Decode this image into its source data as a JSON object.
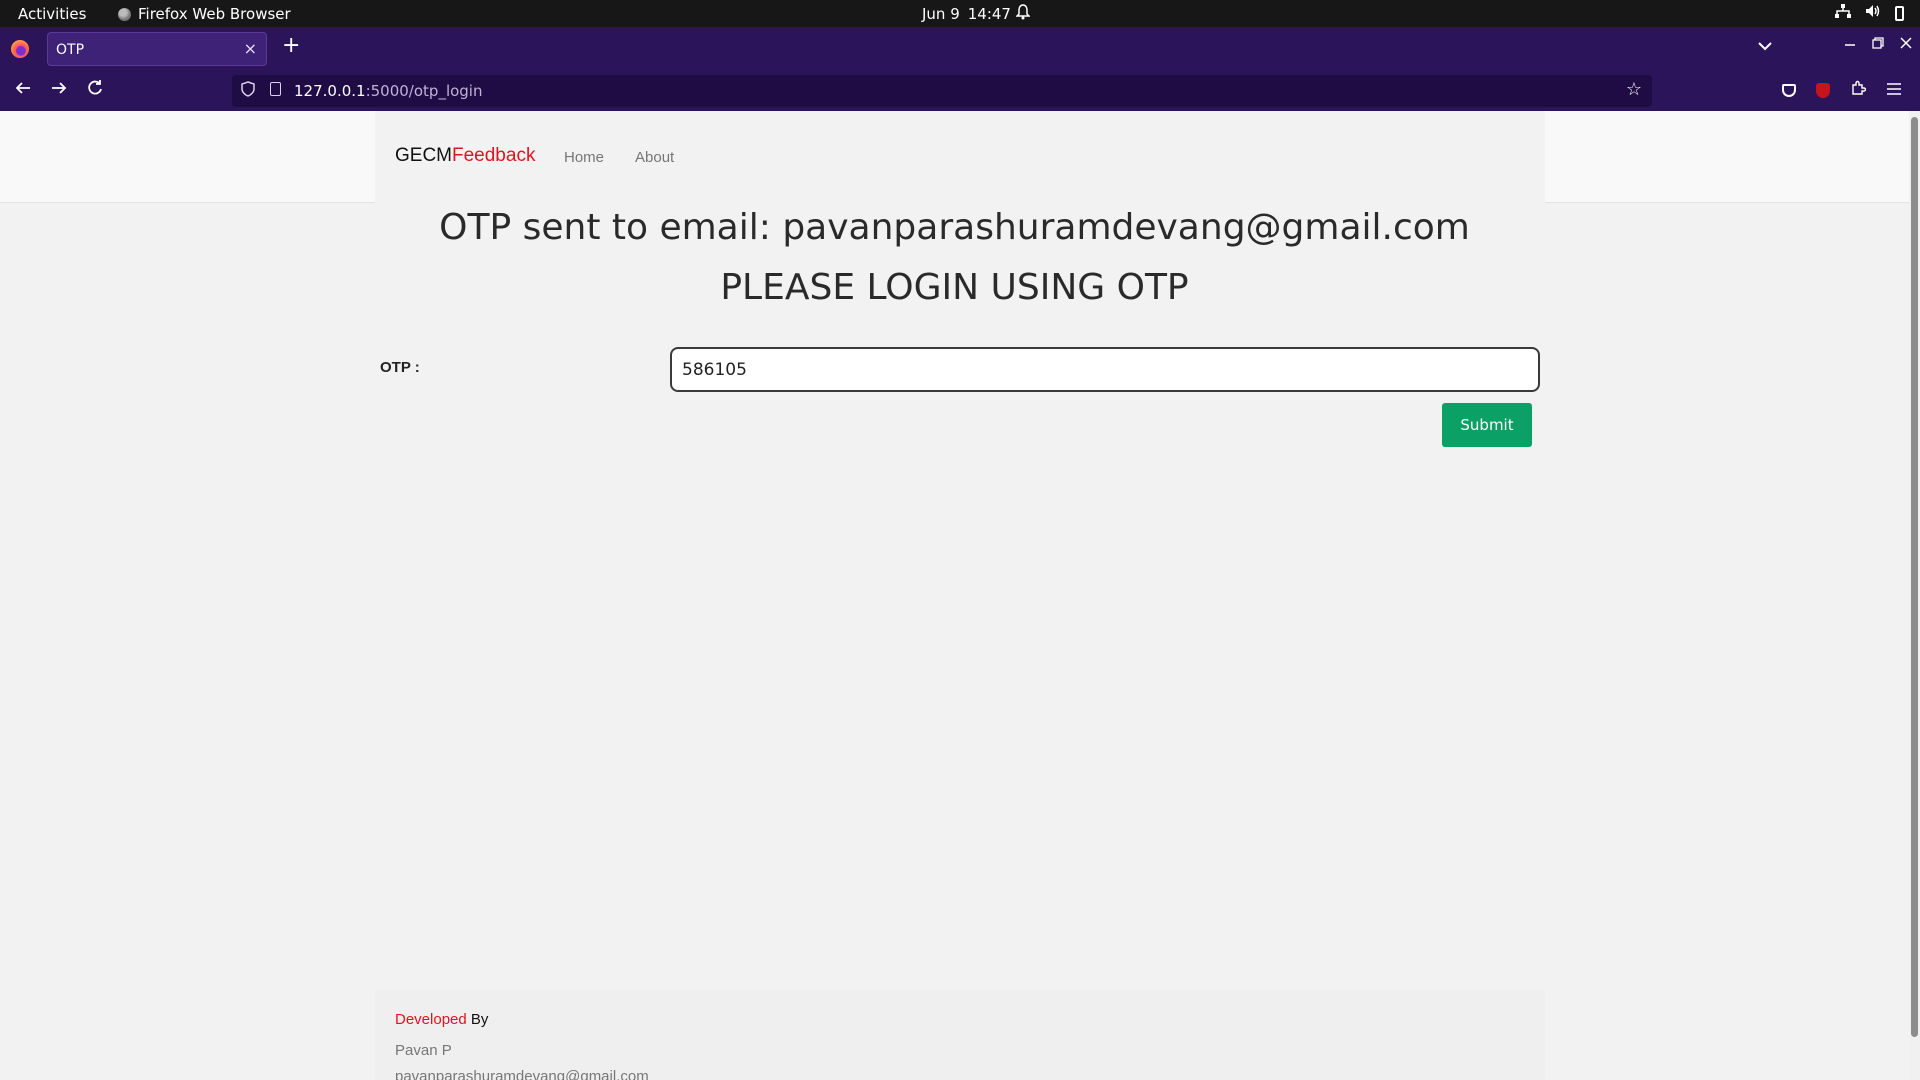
{
  "system_bar": {
    "activities": "Activities",
    "app_name": "Firefox Web Browser",
    "date": "Jun 9",
    "time": "14:47"
  },
  "browser": {
    "tab_title": "OTP",
    "tab_close": "×",
    "new_tab": "+",
    "url_host": "127.0.0.1",
    "url_path": ":5000/otp_login"
  },
  "site": {
    "brand_primary": "GECM",
    "brand_accent": "Feedback",
    "nav": [
      "Home",
      "About"
    ]
  },
  "main": {
    "heading_email": "OTP sent to email: pavanparashuramdevang@gmail.com",
    "heading_instruction": "PLEASE LOGIN USING OTP",
    "otp_label": "OTP :",
    "otp_value": "586105",
    "submit_label": "Submit"
  },
  "footer": {
    "developed": "Developed",
    "by": " By",
    "author": "Pavan P",
    "email": "pavanparashuramdevang@gmail.com"
  },
  "colors": {
    "browser_chrome": "#2b1459",
    "brand_accent": "#e0141e",
    "submit_button": "#0aa066"
  }
}
